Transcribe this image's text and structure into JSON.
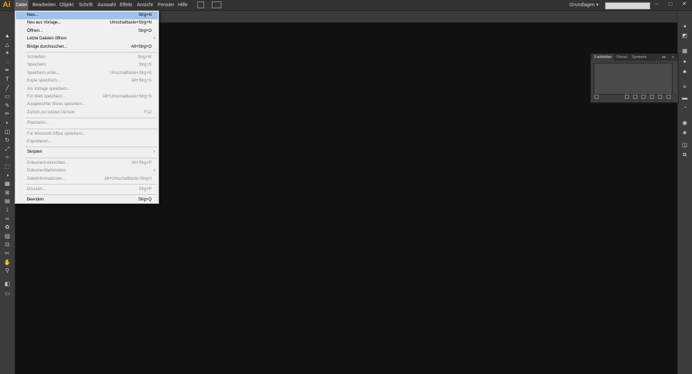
{
  "app": {
    "logo": "Ai"
  },
  "menubar": {
    "items": [
      "Datei",
      "Bearbeiten",
      "Objekt",
      "Schrift",
      "Auswahl",
      "Effekt",
      "Ansicht",
      "Fenster",
      "Hilfe"
    ],
    "workspace": "Grundlagen",
    "workspace_arrow": "▾",
    "window_controls": [
      "–",
      "□",
      "✕"
    ]
  },
  "panel": {
    "tabs": [
      "Farbfelder",
      "Pinsel",
      "Symbole"
    ],
    "collapse": "▸▸",
    "menu": "≡"
  },
  "file_menu": {
    "groups": [
      [
        {
          "label": "Neu...",
          "shortcut": "Strg+N",
          "enabled": true,
          "highlight": true
        },
        {
          "label": "Neu aus Vorlage...",
          "shortcut": "Umschalttaste+Strg+N",
          "enabled": true
        },
        {
          "label": "Öffnen...",
          "shortcut": "Strg+O",
          "enabled": true
        },
        {
          "label": "Letzte Dateien öffnen",
          "shortcut": "",
          "enabled": true,
          "submenu": true
        },
        {
          "label": "Bridge durchsuchen...",
          "shortcut": "Alt+Strg+O",
          "enabled": true
        }
      ],
      [
        {
          "label": "Schließen",
          "shortcut": "Strg+W",
          "enabled": false
        },
        {
          "label": "Speichern",
          "shortcut": "Strg+S",
          "enabled": false
        },
        {
          "label": "Speichern unter...",
          "shortcut": "Umschalttaste+Strg+S",
          "enabled": false
        },
        {
          "label": "Kopie speichern...",
          "shortcut": "Alt+Strg+S",
          "enabled": false
        },
        {
          "label": "Als Vorlage speichern...",
          "shortcut": "",
          "enabled": false
        },
        {
          "label": "Für Web speichern...",
          "shortcut": "Alt+Umschalttaste+Strg+S",
          "enabled": false
        },
        {
          "label": "Ausgewählte Slices speichern...",
          "shortcut": "",
          "enabled": false
        },
        {
          "label": "Zurück zur letzten Version",
          "shortcut": "F12",
          "enabled": false
        }
      ],
      [
        {
          "label": "Platzieren...",
          "shortcut": "",
          "enabled": false
        }
      ],
      [
        {
          "label": "Für Microsoft Office speichern...",
          "shortcut": "",
          "enabled": false
        },
        {
          "label": "Exportieren...",
          "shortcut": "",
          "enabled": false
        }
      ],
      [
        {
          "label": "Skripten",
          "shortcut": "",
          "enabled": true,
          "submenu": true
        }
      ],
      [
        {
          "label": "Dokument einrichten...",
          "shortcut": "Alt+Strg+P",
          "enabled": false
        },
        {
          "label": "Dokumentfarbmodus",
          "shortcut": "",
          "enabled": false,
          "submenu": true
        },
        {
          "label": "Dateiinformationen...",
          "shortcut": "Alt+Umschalttaste+Strg+I",
          "enabled": false
        }
      ],
      [
        {
          "label": "Drucken...",
          "shortcut": "Strg+P",
          "enabled": false
        }
      ],
      [
        {
          "label": "Beenden",
          "shortcut": "Strg+Q",
          "enabled": true
        }
      ]
    ]
  },
  "tools_left": [
    "selection-tool",
    "direct-selection-tool",
    "magic-wand-tool",
    "lasso-tool",
    "pen-tool",
    "type-tool",
    "line-tool",
    "rectangle-tool",
    "paintbrush-tool",
    "pencil-tool",
    "blob-brush-tool",
    "eraser-tool",
    "rotate-tool",
    "scale-tool",
    "width-tool",
    "free-transform-tool",
    "shape-builder-tool",
    "perspective-grid-tool",
    "mesh-tool",
    "gradient-tool",
    "eyedropper-tool",
    "blend-tool",
    "symbol-sprayer-tool",
    "column-graph-tool",
    "artboard-tool",
    "slice-tool",
    "hand-tool",
    "zoom-tool"
  ],
  "tools_right": [
    "color-panel-icon",
    "color-guide-icon",
    "swatches-icon",
    "brushes-icon",
    "symbols-icon",
    "stroke-icon",
    "gradient-icon",
    "transparency-icon",
    "appearance-icon",
    "graphic-styles-icon",
    "layers-icon",
    "artboards-icon"
  ],
  "colors": {
    "accent_logo": "#ff9a00",
    "highlight": "#9fc3ea",
    "canvas": "#111111"
  }
}
